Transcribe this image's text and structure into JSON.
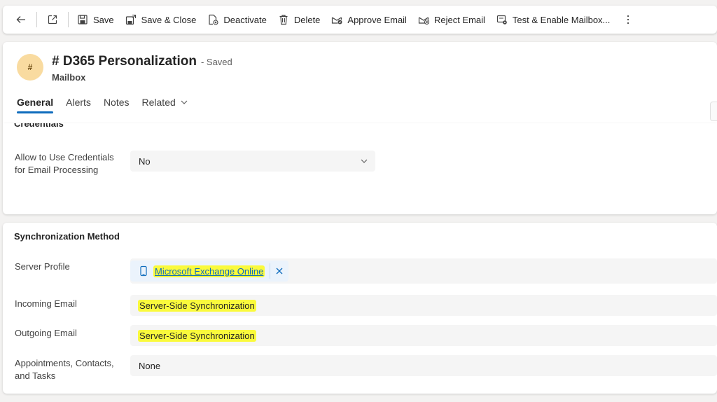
{
  "command_bar": {
    "save": "Save",
    "save_close": "Save & Close",
    "deactivate": "Deactivate",
    "delete": "Delete",
    "approve_email": "Approve Email",
    "reject_email": "Reject Email",
    "test_enable": "Test & Enable Mailbox..."
  },
  "record": {
    "avatar_initials": "#",
    "title": "# D365 Personalization",
    "status": "- Saved",
    "entity": "Mailbox"
  },
  "tabs": [
    "General",
    "Alerts",
    "Notes",
    "Related"
  ],
  "credentials_section": {
    "title": "Credentials",
    "fields": {
      "allow_credentials": {
        "label": "Allow to Use Credentials for Email Processing",
        "value": "No"
      }
    }
  },
  "sync_section": {
    "title": "Synchronization Method",
    "server_profile": {
      "label": "Server Profile",
      "value": "Microsoft Exchange Online"
    },
    "incoming_email": {
      "label": "Incoming Email",
      "value": "Server-Side Synchronization"
    },
    "outgoing_email": {
      "label": "Outgoing Email",
      "value": "Server-Side Synchronization"
    },
    "appointments": {
      "label": "Appointments, Contacts, and Tasks",
      "value": "None"
    }
  },
  "colors": {
    "accent": "#0f6cbd",
    "highlight": "#fafa3c",
    "avatar_bg": "#f9dba0"
  }
}
